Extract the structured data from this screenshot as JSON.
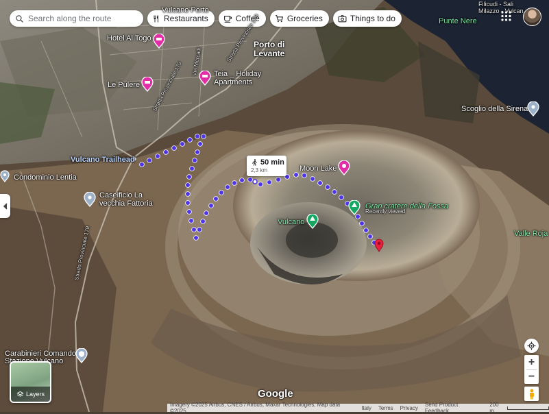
{
  "search": {
    "placeholder": "Search along the route"
  },
  "chips": [
    {
      "label": "Restaurants",
      "icon": "fork-knife-icon"
    },
    {
      "label": "Coffee",
      "icon": "coffee-icon"
    },
    {
      "label": "Groceries",
      "icon": "cart-icon"
    },
    {
      "label": "Things to do",
      "icon": "camera-icon"
    }
  ],
  "top_right": {
    "place": "Punte Nere",
    "cut_text": "Filicudi - Sali",
    "cut_text2": "Milazzo - Vulcan"
  },
  "places": {
    "hotel_al_togo": "Hotel Al Togo",
    "porto_di_levante": "Porto di\nLevante",
    "porto_line1": "Porto di",
    "porto_line2": "Levante",
    "teia_line1": "Teia _ Holiday",
    "teia_line2": "Apartments",
    "le_pulere": "Le Pulere",
    "vulcano_trailhead": "Vulcano Trailhead",
    "condominio_lentia": "Condominio Lentia",
    "caseificio_line1": "Caseificio La",
    "caseificio_line2": "vecchia Fattoria",
    "moon_lake": "Moon Lake",
    "gran_cratere": "Gran cratere della Fossa",
    "recently_viewed": "Recently viewed",
    "vulcano": "Vulcano",
    "scoglio": "Scoglio della Sirena",
    "valle_roja": "Valle Roja",
    "carabinieri_line1": "Carabinieri Comando",
    "carabinieri_line2": "Stazione Vulcano",
    "top_partial": "Vulcano Porto"
  },
  "roads": {
    "sp179_a": "Strada Provinciale 179",
    "sp179_b": "Strada Provinciale 179",
    "sp179_c": "Strada Provinciale 179",
    "via_mercalli": "Via Mercalli"
  },
  "route": {
    "time": "50 min",
    "distance": "2,3 km",
    "mode_icon": "walking-icon",
    "color": "#4f35e8"
  },
  "layers": {
    "label": "Layers"
  },
  "brand": "Google",
  "attribution": {
    "imagery": "Imagery ©2025 Airbus, CNES / Airbus, Maxar Technologies, Map data ©2025",
    "country": "Italy",
    "terms": "Terms",
    "privacy": "Privacy",
    "feedback": "Send Product Feedback",
    "scale": "200 m"
  },
  "colors": {
    "route": "#4f35e8",
    "hotel_pin": "#e12ea6",
    "park_pin": "#14a862",
    "destination_pin": "#ea1f3d"
  }
}
